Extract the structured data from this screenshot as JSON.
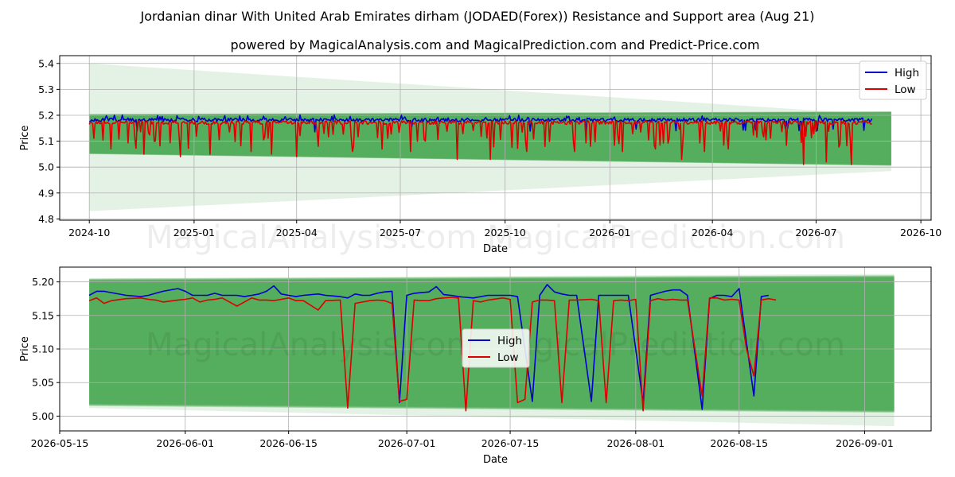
{
  "title_line1": "Jordanian dinar With United Arab Emirates dirham (JODAED(Forex)) Resistance and Support area (Aug 21)",
  "title_line2": "powered by MagicalAnalysis.com and MagicalPrediction.com and Predict-Price.com",
  "watermark": "MagicalAnalysis.com      MagicalPrediction.com",
  "colors": {
    "high": "#0000cc",
    "low": "#dd0000",
    "band": "#2e9a36",
    "band_light": "#cfe8cc",
    "grid": "#b0b0b0"
  },
  "chart_data": [
    {
      "type": "line",
      "name": "top",
      "xlabel": "Date",
      "ylabel": "Price",
      "xlim": [
        "2024-09-05",
        "2026-10-10"
      ],
      "ylim": [
        4.795,
        5.43
      ],
      "x_ticks": [
        "2024-10-01",
        "2025-01-01",
        "2025-04-01",
        "2025-07-01",
        "2025-10-01",
        "2026-01-01",
        "2026-04-01",
        "2026-07-01",
        "2026-10-01"
      ],
      "x_tick_labels": [
        "2024-10",
        "2025-01",
        "2025-04",
        "2025-07",
        "2025-10",
        "2026-01",
        "2026-04",
        "2026-07",
        "2026-10"
      ],
      "y_ticks": [
        4.8,
        4.9,
        5.0,
        5.1,
        5.2,
        5.3,
        5.4
      ],
      "y_tick_labels": [
        "4.8",
        "4.9",
        "5.0",
        "5.1",
        "5.2",
        "5.3",
        "5.4"
      ],
      "legend": [
        "High",
        "Low"
      ],
      "legend_position": "upper right",
      "grid": true,
      "series": [
        {
          "name": "High",
          "x_start": "2024-10-01",
          "x_end": "2026-08-19",
          "base": 5.182,
          "dips": []
        },
        {
          "name": "Low",
          "x_start": "2024-10-01",
          "x_end": "2026-08-19",
          "base": 5.172,
          "dips": [
            [
              "2024-10-20",
              5.07
            ],
            [
              "2024-11-18",
              5.05
            ],
            [
              "2024-12-20",
              5.04
            ],
            [
              "2025-01-15",
              5.05
            ],
            [
              "2025-02-20",
              5.06
            ],
            [
              "2025-03-10",
              5.05
            ],
            [
              "2025-04-01",
              5.04
            ],
            [
              "2025-04-20",
              5.08
            ],
            [
              "2025-05-20",
              5.06
            ],
            [
              "2025-06-15",
              5.07
            ],
            [
              "2025-07-10",
              5.06
            ],
            [
              "2025-08-20",
              5.03
            ],
            [
              "2025-09-18",
              5.03
            ],
            [
              "2025-10-20",
              5.06
            ],
            [
              "2025-12-01",
              5.06
            ],
            [
              "2026-01-12",
              5.06
            ],
            [
              "2026-02-10",
              5.07
            ],
            [
              "2026-03-05",
              5.03
            ],
            [
              "2026-03-25",
              5.06
            ],
            [
              "2026-04-15",
              5.07
            ],
            [
              "2026-06-20",
              5.01
            ],
            [
              "2026-07-10",
              5.02
            ],
            [
              "2026-08-01",
              5.01
            ]
          ]
        }
      ],
      "bands": {
        "x_start": "2024-10-01",
        "x_end": "2026-09-05",
        "dark_top": [
          5.205,
          5.215
        ],
        "dark_bottom": [
          5.05,
          5.005
        ],
        "light_top": [
          5.4,
          5.2
        ],
        "light_bottom": [
          4.83,
          4.985
        ]
      }
    },
    {
      "type": "line",
      "name": "bottom",
      "xlabel": "Date",
      "ylabel": "Price",
      "xlim": [
        "2026-05-15",
        "2026-09-10"
      ],
      "ylim": [
        4.978,
        5.222
      ],
      "x_ticks": [
        "2026-05-15",
        "2026-06-01",
        "2026-06-15",
        "2026-07-01",
        "2026-07-15",
        "2026-08-01",
        "2026-08-15",
        "2026-09-01"
      ],
      "x_tick_labels": [
        "2026-05-15",
        "2026-06-01",
        "2026-06-15",
        "2026-07-01",
        "2026-07-15",
        "2026-08-01",
        "2026-08-15",
        "2026-09-01"
      ],
      "y_ticks": [
        5.0,
        5.05,
        5.1,
        5.15,
        5.2
      ],
      "y_tick_labels": [
        "5.00",
        "5.05",
        "5.10",
        "5.15",
        "5.20"
      ],
      "legend": [
        "High",
        "Low"
      ],
      "legend_position": "center",
      "grid": true,
      "series": [
        {
          "name": "High",
          "points": [
            [
              "2026-05-19",
              5.18
            ],
            [
              "2026-05-20",
              5.186
            ],
            [
              "2026-05-21",
              5.186
            ],
            [
              "2026-05-22",
              5.184
            ],
            [
              "2026-05-24",
              5.18
            ],
            [
              "2026-05-26",
              5.178
            ],
            [
              "2026-05-27",
              5.18
            ],
            [
              "2026-05-28",
              5.183
            ],
            [
              "2026-05-29",
              5.186
            ],
            [
              "2026-05-31",
              5.19
            ],
            [
              "2026-06-01",
              5.186
            ],
            [
              "2026-06-02",
              5.18
            ],
            [
              "2026-06-03",
              5.18
            ],
            [
              "2026-06-04",
              5.18
            ],
            [
              "2026-06-05",
              5.183
            ],
            [
              "2026-06-06",
              5.18
            ],
            [
              "2026-06-08",
              5.18
            ],
            [
              "2026-06-09",
              5.178
            ],
            [
              "2026-06-10",
              5.18
            ],
            [
              "2026-06-11",
              5.182
            ],
            [
              "2026-06-12",
              5.186
            ],
            [
              "2026-06-13",
              5.194
            ],
            [
              "2026-06-14",
              5.182
            ],
            [
              "2026-06-15",
              5.18
            ],
            [
              "2026-06-16",
              5.178
            ],
            [
              "2026-06-17",
              5.18
            ],
            [
              "2026-06-19",
              5.182
            ],
            [
              "2026-06-20",
              5.18
            ],
            [
              "2026-06-22",
              5.178
            ],
            [
              "2026-06-23",
              5.176
            ],
            [
              "2026-06-24",
              5.182
            ],
            [
              "2026-06-25",
              5.18
            ],
            [
              "2026-06-26",
              5.18
            ],
            [
              "2026-06-27",
              5.183
            ],
            [
              "2026-06-28",
              5.185
            ],
            [
              "2026-06-29",
              5.186
            ],
            [
              "2026-06-30",
              5.02
            ],
            [
              "2026-07-01",
              5.18
            ],
            [
              "2026-07-02",
              5.183
            ],
            [
              "2026-07-03",
              5.184
            ],
            [
              "2026-07-04",
              5.185
            ],
            [
              "2026-07-05",
              5.193
            ],
            [
              "2026-07-06",
              5.181
            ],
            [
              "2026-07-07",
              5.18
            ],
            [
              "2026-07-08",
              5.178
            ],
            [
              "2026-07-09",
              5.177
            ],
            [
              "2026-07-10",
              5.176
            ],
            [
              "2026-07-11",
              5.178
            ],
            [
              "2026-07-12",
              5.18
            ],
            [
              "2026-07-14",
              5.18
            ],
            [
              "2026-07-15",
              5.18
            ],
            [
              "2026-07-16",
              5.178
            ],
            [
              "2026-07-18",
              5.022
            ],
            [
              "2026-07-19",
              5.18
            ],
            [
              "2026-07-20",
              5.196
            ],
            [
              "2026-07-21",
              5.185
            ],
            [
              "2026-07-22",
              5.182
            ],
            [
              "2026-07-23",
              5.18
            ],
            [
              "2026-07-24",
              5.18
            ],
            [
              "2026-07-26",
              5.022
            ],
            [
              "2026-07-27",
              5.18
            ],
            [
              "2026-07-28",
              5.18
            ],
            [
              "2026-07-29",
              5.18
            ],
            [
              "2026-07-30",
              5.18
            ],
            [
              "2026-07-31",
              5.18
            ],
            [
              "2026-08-02",
              5.02
            ],
            [
              "2026-08-03",
              5.18
            ],
            [
              "2026-08-04",
              5.183
            ],
            [
              "2026-08-05",
              5.186
            ],
            [
              "2026-08-06",
              5.188
            ],
            [
              "2026-08-07",
              5.188
            ],
            [
              "2026-08-08",
              5.18
            ],
            [
              "2026-08-10",
              5.01
            ],
            [
              "2026-08-11",
              5.175
            ],
            [
              "2026-08-12",
              5.18
            ],
            [
              "2026-08-13",
              5.18
            ],
            [
              "2026-08-14",
              5.178
            ],
            [
              "2026-08-15",
              5.19
            ],
            [
              "2026-08-17",
              5.03
            ],
            [
              "2026-08-18",
              5.178
            ],
            [
              "2026-08-19",
              5.18
            ]
          ]
        },
        {
          "name": "Low",
          "points": [
            [
              "2026-05-19",
              5.172
            ],
            [
              "2026-05-20",
              5.176
            ],
            [
              "2026-05-21",
              5.168
            ],
            [
              "2026-05-22",
              5.172
            ],
            [
              "2026-05-24",
              5.175
            ],
            [
              "2026-05-26",
              5.176
            ],
            [
              "2026-05-27",
              5.174
            ],
            [
              "2026-05-28",
              5.173
            ],
            [
              "2026-05-29",
              5.17
            ],
            [
              "2026-05-31",
              5.173
            ],
            [
              "2026-06-01",
              5.174
            ],
            [
              "2026-06-02",
              5.176
            ],
            [
              "2026-06-03",
              5.17
            ],
            [
              "2026-06-04",
              5.173
            ],
            [
              "2026-06-05",
              5.174
            ],
            [
              "2026-06-06",
              5.176
            ],
            [
              "2026-06-08",
              5.164
            ],
            [
              "2026-06-09",
              5.17
            ],
            [
              "2026-06-10",
              5.176
            ],
            [
              "2026-06-11",
              5.173
            ],
            [
              "2026-06-12",
              5.173
            ],
            [
              "2026-06-13",
              5.172
            ],
            [
              "2026-06-14",
              5.174
            ],
            [
              "2026-06-15",
              5.176
            ],
            [
              "2026-06-16",
              5.172
            ],
            [
              "2026-06-17",
              5.172
            ],
            [
              "2026-06-19",
              5.158
            ],
            [
              "2026-06-20",
              5.172
            ],
            [
              "2026-06-22",
              5.173
            ],
            [
              "2026-06-23",
              5.012
            ],
            [
              "2026-06-24",
              5.168
            ],
            [
              "2026-06-25",
              5.17
            ],
            [
              "2026-06-26",
              5.172
            ],
            [
              "2026-06-27",
              5.173
            ],
            [
              "2026-06-28",
              5.172
            ],
            [
              "2026-06-29",
              5.168
            ],
            [
              "2026-06-30",
              5.022
            ],
            [
              "2026-07-01",
              5.025
            ],
            [
              "2026-07-02",
              5.173
            ],
            [
              "2026-07-03",
              5.172
            ],
            [
              "2026-07-04",
              5.172
            ],
            [
              "2026-07-05",
              5.175
            ],
            [
              "2026-07-06",
              5.176
            ],
            [
              "2026-07-07",
              5.177
            ],
            [
              "2026-07-08",
              5.176
            ],
            [
              "2026-07-09",
              5.008
            ],
            [
              "2026-07-10",
              5.172
            ],
            [
              "2026-07-11",
              5.17
            ],
            [
              "2026-07-12",
              5.173
            ],
            [
              "2026-07-14",
              5.176
            ],
            [
              "2026-07-15",
              5.174
            ],
            [
              "2026-07-16",
              5.02
            ],
            [
              "2026-07-17",
              5.025
            ],
            [
              "2026-07-18",
              5.17
            ],
            [
              "2026-07-19",
              5.173
            ],
            [
              "2026-07-20",
              5.173
            ],
            [
              "2026-07-21",
              5.172
            ],
            [
              "2026-07-22",
              5.02
            ],
            [
              "2026-07-23",
              5.173
            ],
            [
              "2026-07-24",
              5.173
            ],
            [
              "2026-07-26",
              5.174
            ],
            [
              "2026-07-27",
              5.172
            ],
            [
              "2026-07-28",
              5.02
            ],
            [
              "2026-07-29",
              5.172
            ],
            [
              "2026-07-30",
              5.173
            ],
            [
              "2026-07-31",
              5.172
            ],
            [
              "2026-08-01",
              5.174
            ],
            [
              "2026-08-02",
              5.008
            ],
            [
              "2026-08-03",
              5.172
            ],
            [
              "2026-08-04",
              5.175
            ],
            [
              "2026-08-05",
              5.173
            ],
            [
              "2026-08-06",
              5.174
            ],
            [
              "2026-08-07",
              5.173
            ],
            [
              "2026-08-08",
              5.173
            ],
            [
              "2026-08-10",
              5.03
            ],
            [
              "2026-08-11",
              5.176
            ],
            [
              "2026-08-12",
              5.176
            ],
            [
              "2026-08-13",
              5.173
            ],
            [
              "2026-08-14",
              5.174
            ],
            [
              "2026-08-15",
              5.173
            ],
            [
              "2026-08-16",
              5.1
            ],
            [
              "2026-08-17",
              5.06
            ],
            [
              "2026-08-18",
              5.173
            ],
            [
              "2026-08-19",
              5.175
            ],
            [
              "2026-08-20",
              5.173
            ]
          ]
        }
      ],
      "bands": {
        "x_start": "2026-05-19",
        "x_end": "2026-09-05",
        "dark_top": [
          5.205,
          5.21
        ],
        "dark_bottom": [
          5.015,
          5.005
        ],
        "light_top": [
          5.205,
          5.212
        ],
        "light_bottom": [
          5.012,
          4.985
        ]
      }
    }
  ]
}
